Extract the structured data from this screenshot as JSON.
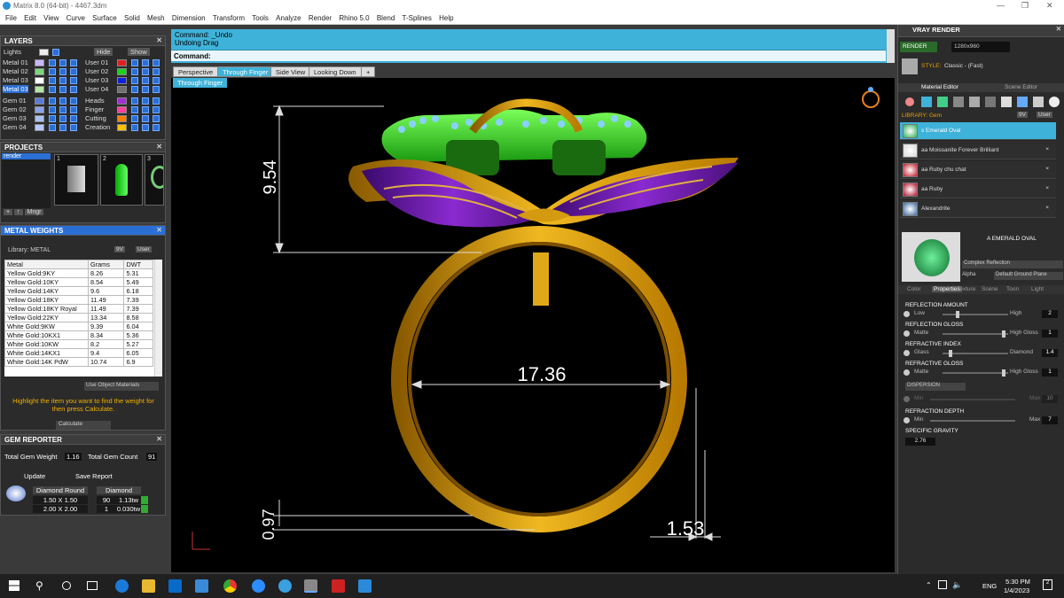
{
  "app": {
    "title": "Matrix 8.0 (64-bit) - 4467.3dm"
  },
  "menu": [
    "File",
    "Edit",
    "View",
    "Curve",
    "Surface",
    "Solid",
    "Mesh",
    "Dimension",
    "Transform",
    "Tools",
    "Analyze",
    "Render",
    "Rhino 5.0",
    "Blend",
    "T-Splines",
    "Help"
  ],
  "layers": {
    "title": "LAYERS",
    "lights": "Lights",
    "hide": "Hide",
    "show": "Show",
    "left": [
      {
        "name": "Metal 01",
        "color": "#c8b8ff"
      },
      {
        "name": "Metal 02",
        "color": "#7dd67d"
      },
      {
        "name": "Metal 03",
        "color": "#ffffff"
      },
      {
        "name": "Metal 03",
        "color": "#b5e6a5"
      },
      {
        "name": "Gem 01",
        "color": "#5b7bd6"
      },
      {
        "name": "Gem 02",
        "color": "#8ba4e8"
      },
      {
        "name": "Gem 03",
        "color": "#aac0f0"
      },
      {
        "name": "Gem 04",
        "color": "#b8c8ff"
      }
    ],
    "right": [
      {
        "name": "User 01",
        "color": "#e02020"
      },
      {
        "name": "User 02",
        "color": "#20d020"
      },
      {
        "name": "User 03",
        "color": "#1020e0"
      },
      {
        "name": "User 04",
        "color": "#707070"
      },
      {
        "name": "Heads",
        "color": "#a030d0"
      },
      {
        "name": "Finger",
        "color": "#ff40a0"
      },
      {
        "name": "Cutting",
        "color": "#ff8000"
      },
      {
        "name": "Creation",
        "color": "#ffc000"
      }
    ]
  },
  "projects": {
    "title": "PROJECTS",
    "item": "render",
    "thumbs": [
      "1",
      "2",
      "3"
    ],
    "mngr": "Mngr"
  },
  "metal_weights": {
    "title": "METAL WEIGHTS",
    "library": "Library: METAL",
    "lib_btns": [
      "9V",
      "User"
    ],
    "headers": [
      "Metal",
      "Grams",
      "DWT"
    ],
    "rows": [
      [
        "Yellow Gold:9KY",
        "8.26",
        "5.31"
      ],
      [
        "Yellow Gold:10KY",
        "8.54",
        "5.49"
      ],
      [
        "Yellow Gold:14KY",
        "9.6",
        "6.18"
      ],
      [
        "Yellow Gold:18KY",
        "11.49",
        "7.39"
      ],
      [
        "Yellow Gold:18KY Royal",
        "11.49",
        "7.39"
      ],
      [
        "Yellow Gold:22KY",
        "13.34",
        "8.58"
      ],
      [
        "White Gold:9KW",
        "9.39",
        "6.04"
      ],
      [
        "White Gold:10KX1",
        "8.34",
        "5.36"
      ],
      [
        "White Gold:10KW",
        "8.2",
        "5.27"
      ],
      [
        "White Gold:14KX1",
        "9.4",
        "6.05"
      ],
      [
        "White Gold:14K PdW",
        "10.74",
        "6.9"
      ]
    ],
    "use_obj": "Use Object Materials",
    "hint": "Highlight the item you want to find the weight for then press Calculate.",
    "calculate": "Calculate"
  },
  "gem_reporter": {
    "title": "GEM REPORTER",
    "total_weight_label": "Total Gem Weight",
    "total_weight": "1.16",
    "total_count_label": "Total Gem Count",
    "total_count": "91",
    "update": "Update",
    "save": "Save Report",
    "headers": [
      "Diamond Round",
      "Diamond"
    ],
    "rows": [
      [
        "1.50 X 1.50",
        "90",
        "1.13tw"
      ],
      [
        "2.00 X 2.00",
        "1",
        "0.030tw"
      ]
    ]
  },
  "command": {
    "line1": "Command: _Undo",
    "line2": "Undoing Drag",
    "prompt": "Command:"
  },
  "view_tabs": [
    "Perspective",
    "Through Finger",
    "Side View",
    "Looking Down",
    "+"
  ],
  "viewport_label": "Through Finger",
  "dims": {
    "height": "9.54",
    "width": "17.36",
    "thickness": "0.97",
    "band": "1.53"
  },
  "vray": {
    "title": "VRAY RENDER",
    "render": "RENDER",
    "res": "1280x960",
    "style_label": "STYLE:",
    "style": "Classic - (Fast)",
    "tabs": [
      "Material Editor",
      "Scene Editor"
    ],
    "library": "LIBRARY: Gem",
    "lib_btns": [
      "9V",
      "User"
    ],
    "materials": [
      {
        "name": "s Emerald Oval",
        "color": "#2fae5a"
      },
      {
        "name": "aa Moissanite Forever Brilliant",
        "color": "#d8d8d8"
      },
      {
        "name": "aa Ruby chu chat",
        "color": "#c01a2a"
      },
      {
        "name": "aa Ruby",
        "color": "#b0102a"
      },
      {
        "name": "Alexandrite",
        "color": "#3a6a9a"
      }
    ],
    "preview_name": "A EMERALD OVAL",
    "complex": "Complex Reflection",
    "alpha": "Alpha",
    "default_ground": "Default Ground Plane",
    "sub_tabs": [
      "Color",
      "Properties",
      "Texture",
      "Scene",
      "Toon",
      "Light"
    ],
    "props": [
      {
        "section": "REFLECTION AMOUNT",
        "low": "Low",
        "high": "High",
        "val": "2",
        "pos": 0.2
      },
      {
        "section": "REFLECTION GLOSS",
        "low": "Matte",
        "high": "High Gloss",
        "val": "1",
        "pos": 0.9
      },
      {
        "section": "REFRACTIVE INDEX",
        "low": "Glass",
        "high": "Diamond",
        "val": "1.4",
        "pos": 0.1
      },
      {
        "section": "REFRACTIVE GLOSS",
        "low": "Matte",
        "high": "High Gloss",
        "val": "1",
        "pos": 0.9
      }
    ],
    "dispersion": "DISPERSION",
    "disp_low": "Min",
    "disp_high": "Max",
    "disp_val": "10",
    "depth_section": "REFRACTION DEPTH",
    "depth_low": "Min",
    "depth_high": "Max",
    "depth_val": "7",
    "sg_label": "SPECIFIC GRAVITY",
    "sg": "2.76"
  },
  "taskbar": {
    "time": "5:30 PM",
    "date": "1/4/2023",
    "lang": "ENG",
    "notif": "2"
  },
  "colors": {
    "accent": "#3fb2d9",
    "gold": "#e8a818",
    "purple": "#6a1aa8",
    "green": "#33cc22"
  }
}
